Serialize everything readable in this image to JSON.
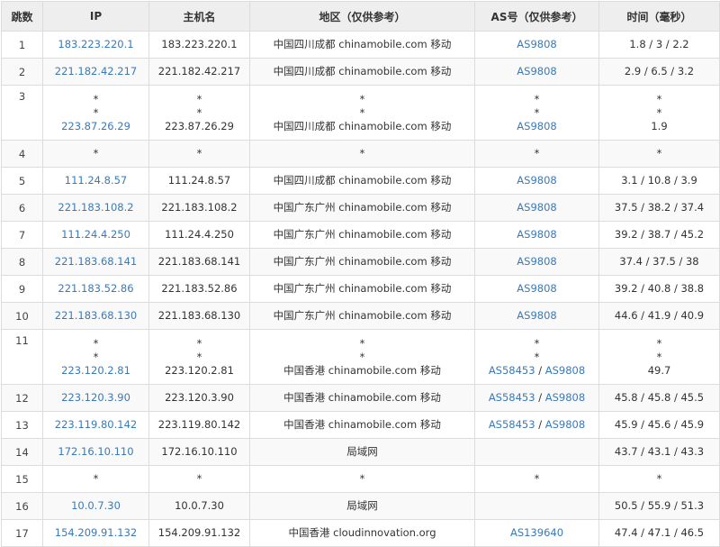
{
  "headers": [
    "跳数",
    "IP",
    "主机名",
    "地区（仅供参考）",
    "AS号（仅供参考）",
    "时间（毫秒）"
  ],
  "rows": [
    {
      "hop": "1",
      "ip": [
        "183.223.220.1"
      ],
      "host": [
        "183.223.220.1"
      ],
      "region": [
        "中国四川成都 chinamobile.com 移动"
      ],
      "as": [
        [
          "AS9808"
        ]
      ],
      "time": [
        "1.8 / 3 / 2.2"
      ]
    },
    {
      "hop": "2",
      "ip": [
        "221.182.42.217"
      ],
      "host": [
        "221.182.42.217"
      ],
      "region": [
        "中国四川成都 chinamobile.com 移动"
      ],
      "as": [
        [
          "AS9808"
        ]
      ],
      "time": [
        "2.9 / 6.5 / 3.2"
      ]
    },
    {
      "hop": "3",
      "ip": [
        "*",
        "*",
        "223.87.26.29"
      ],
      "host": [
        "*",
        "*",
        "223.87.26.29"
      ],
      "region": [
        "*",
        "*",
        "中国四川成都 chinamobile.com 移动"
      ],
      "as": [
        [
          "*"
        ],
        [
          "*"
        ],
        [
          "AS9808"
        ]
      ],
      "time": [
        "*",
        "*",
        "1.9"
      ]
    },
    {
      "hop": "4",
      "ip": [
        "*"
      ],
      "host": [
        "*"
      ],
      "region": [
        "*"
      ],
      "as": [
        [
          "*"
        ]
      ],
      "time": [
        "*"
      ]
    },
    {
      "hop": "5",
      "ip": [
        "111.24.8.57"
      ],
      "host": [
        "111.24.8.57"
      ],
      "region": [
        "中国四川成都 chinamobile.com 移动"
      ],
      "as": [
        [
          "AS9808"
        ]
      ],
      "time": [
        "3.1 / 10.8 / 3.9"
      ]
    },
    {
      "hop": "6",
      "ip": [
        "221.183.108.2"
      ],
      "host": [
        "221.183.108.2"
      ],
      "region": [
        "中国广东广州 chinamobile.com 移动"
      ],
      "as": [
        [
          "AS9808"
        ]
      ],
      "time": [
        "37.5 / 38.2 / 37.4"
      ]
    },
    {
      "hop": "7",
      "ip": [
        "111.24.4.250"
      ],
      "host": [
        "111.24.4.250"
      ],
      "region": [
        "中国广东广州 chinamobile.com 移动"
      ],
      "as": [
        [
          "AS9808"
        ]
      ],
      "time": [
        "39.2 / 38.7 / 45.2"
      ]
    },
    {
      "hop": "8",
      "ip": [
        "221.183.68.141"
      ],
      "host": [
        "221.183.68.141"
      ],
      "region": [
        "中国广东广州 chinamobile.com 移动"
      ],
      "as": [
        [
          "AS9808"
        ]
      ],
      "time": [
        "37.4 / 37.5 / 38"
      ]
    },
    {
      "hop": "9",
      "ip": [
        "221.183.52.86"
      ],
      "host": [
        "221.183.52.86"
      ],
      "region": [
        "中国广东广州 chinamobile.com 移动"
      ],
      "as": [
        [
          "AS9808"
        ]
      ],
      "time": [
        "39.2 / 40.8 / 38.8"
      ]
    },
    {
      "hop": "10",
      "ip": [
        "221.183.68.130"
      ],
      "host": [
        "221.183.68.130"
      ],
      "region": [
        "中国广东广州 chinamobile.com 移动"
      ],
      "as": [
        [
          "AS9808"
        ]
      ],
      "time": [
        "44.6 / 41.9 / 40.9"
      ]
    },
    {
      "hop": "11",
      "ip": [
        "*",
        "*",
        "223.120.2.81"
      ],
      "host": [
        "*",
        "*",
        "223.120.2.81"
      ],
      "region": [
        "*",
        "*",
        "中国香港 chinamobile.com 移动"
      ],
      "as": [
        [
          "*"
        ],
        [
          "*"
        ],
        [
          "AS58453",
          "AS9808"
        ]
      ],
      "time": [
        "*",
        "*",
        "49.7"
      ]
    },
    {
      "hop": "12",
      "ip": [
        "223.120.3.90"
      ],
      "host": [
        "223.120.3.90"
      ],
      "region": [
        "中国香港 chinamobile.com 移动"
      ],
      "as": [
        [
          "AS58453",
          "AS9808"
        ]
      ],
      "time": [
        "45.8 / 45.8 / 45.5"
      ]
    },
    {
      "hop": "13",
      "ip": [
        "223.119.80.142"
      ],
      "host": [
        "223.119.80.142"
      ],
      "region": [
        "中国香港 chinamobile.com 移动"
      ],
      "as": [
        [
          "AS58453",
          "AS9808"
        ]
      ],
      "time": [
        "45.9 / 45.6 / 45.9"
      ]
    },
    {
      "hop": "14",
      "ip": [
        "172.16.10.110"
      ],
      "host": [
        "172.16.10.110"
      ],
      "region": [
        "局域网"
      ],
      "as": [
        []
      ],
      "time": [
        "43.7 / 43.1 / 43.3"
      ]
    },
    {
      "hop": "15",
      "ip": [
        "*"
      ],
      "host": [
        "*"
      ],
      "region": [
        "*"
      ],
      "as": [
        [
          "*"
        ]
      ],
      "time": [
        "*"
      ]
    },
    {
      "hop": "16",
      "ip": [
        "10.0.7.30"
      ],
      "host": [
        "10.0.7.30"
      ],
      "region": [
        "局域网"
      ],
      "as": [
        []
      ],
      "time": [
        "50.5 / 55.9 / 51.3"
      ]
    },
    {
      "hop": "17",
      "ip": [
        "154.209.91.132"
      ],
      "host": [
        "154.209.91.132"
      ],
      "region": [
        "中国香港 cloudinnovation.org"
      ],
      "as": [
        [
          "AS139640"
        ]
      ],
      "time": [
        "47.4 / 47.1 / 46.5"
      ]
    }
  ],
  "colors": {
    "link": "#3a7ab8",
    "header_bg": "#eeeeee",
    "border": "#dcdcdc"
  }
}
